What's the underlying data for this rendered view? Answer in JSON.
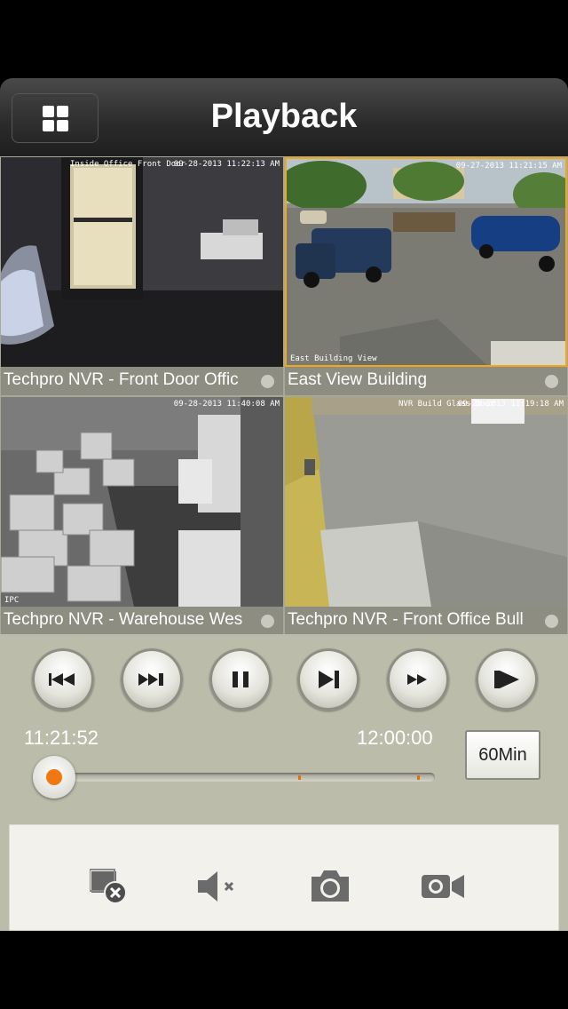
{
  "header": {
    "title": "Playback"
  },
  "cameras": [
    {
      "label": "Techpro NVR - Front Door Offic",
      "osd_name": "Inside Office Front Door",
      "osd_time": "09-28-2013 11:22:13 AM",
      "selected": false
    },
    {
      "label": "East View Building",
      "osd_name": "East Building View",
      "osd_time": "09-27-2013 11:21:15 AM",
      "selected": true
    },
    {
      "label": "Techpro NVR - Warehouse Wes",
      "osd_name": "IPC",
      "osd_time": "09-28-2013 11:40:08 AM",
      "selected": false
    },
    {
      "label": "Techpro NVR - Front Office Bull",
      "osd_name": "NVR Build Glass Door",
      "osd_time": "09-28-2013 11:19:18 AM",
      "selected": false
    }
  ],
  "controls": {
    "buttons": [
      "skip-back-icon",
      "fast-forward-double-icon",
      "pause-icon",
      "step-forward-icon",
      "fast-forward-icon",
      "play-icon"
    ],
    "start_time": "11:21:52",
    "end_time": "12:00:00",
    "range_button": "60Min",
    "progress": 0.0,
    "accent_color": "#f07812"
  },
  "tools": [
    "close-channel-icon",
    "mute-icon",
    "snapshot-icon",
    "record-icon"
  ]
}
